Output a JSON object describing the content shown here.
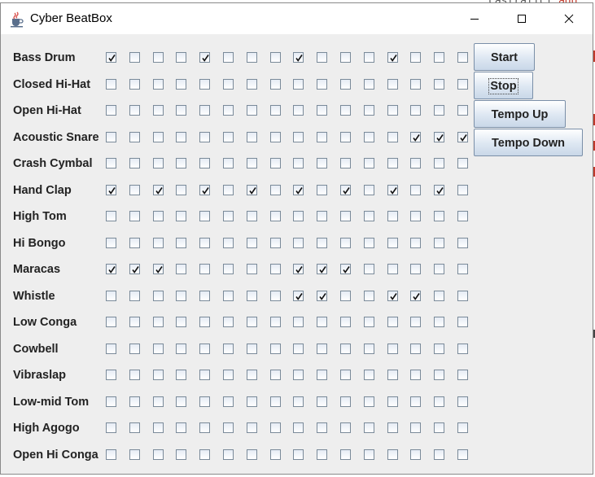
{
  "window": {
    "title": "Cyber BeatBox"
  },
  "background": {
    "code_prefix": "castrafici.",
    "code_highlight": "add"
  },
  "instruments": [
    "Bass Drum",
    "Closed Hi-Hat",
    "Open Hi-Hat",
    "Acoustic Snare",
    "Crash Cymbal",
    "Hand Clap",
    "High Tom",
    "Hi Bongo",
    "Maracas",
    "Whistle",
    "Low Conga",
    "Cowbell",
    "Vibraslap",
    "Low-mid Tom",
    "High Agogo",
    "Open Hi Conga"
  ],
  "beats_per_row": 16,
  "pattern": [
    [
      1,
      0,
      0,
      0,
      1,
      0,
      0,
      0,
      1,
      0,
      0,
      0,
      1,
      0,
      0,
      0
    ],
    [
      0,
      0,
      0,
      0,
      0,
      0,
      0,
      0,
      0,
      0,
      0,
      0,
      0,
      0,
      0,
      0
    ],
    [
      0,
      0,
      0,
      0,
      0,
      0,
      0,
      0,
      0,
      0,
      0,
      0,
      0,
      0,
      0,
      0
    ],
    [
      0,
      0,
      0,
      0,
      0,
      0,
      0,
      0,
      0,
      0,
      0,
      0,
      0,
      1,
      1,
      1
    ],
    [
      0,
      0,
      0,
      0,
      0,
      0,
      0,
      0,
      0,
      0,
      0,
      0,
      0,
      0,
      0,
      0
    ],
    [
      1,
      0,
      1,
      0,
      1,
      0,
      1,
      0,
      1,
      0,
      1,
      0,
      1,
      0,
      1,
      0
    ],
    [
      0,
      0,
      0,
      0,
      0,
      0,
      0,
      0,
      0,
      0,
      0,
      0,
      0,
      0,
      0,
      0
    ],
    [
      0,
      0,
      0,
      0,
      0,
      0,
      0,
      0,
      0,
      0,
      0,
      0,
      0,
      0,
      0,
      0
    ],
    [
      1,
      1,
      1,
      0,
      0,
      0,
      0,
      0,
      1,
      1,
      1,
      0,
      0,
      0,
      0,
      0
    ],
    [
      0,
      0,
      0,
      0,
      0,
      0,
      0,
      0,
      1,
      1,
      0,
      0,
      1,
      1,
      0,
      0
    ],
    [
      0,
      0,
      0,
      0,
      0,
      0,
      0,
      0,
      0,
      0,
      0,
      0,
      0,
      0,
      0,
      0
    ],
    [
      0,
      0,
      0,
      0,
      0,
      0,
      0,
      0,
      0,
      0,
      0,
      0,
      0,
      0,
      0,
      0
    ],
    [
      0,
      0,
      0,
      0,
      0,
      0,
      0,
      0,
      0,
      0,
      0,
      0,
      0,
      0,
      0,
      0
    ],
    [
      0,
      0,
      0,
      0,
      0,
      0,
      0,
      0,
      0,
      0,
      0,
      0,
      0,
      0,
      0,
      0
    ],
    [
      0,
      0,
      0,
      0,
      0,
      0,
      0,
      0,
      0,
      0,
      0,
      0,
      0,
      0,
      0,
      0
    ],
    [
      0,
      0,
      0,
      0,
      0,
      0,
      0,
      0,
      0,
      0,
      0,
      0,
      0,
      0,
      0,
      0
    ]
  ],
  "buttons": {
    "start": "Start",
    "stop": "Stop",
    "tempo_up": "Tempo Up",
    "tempo_down": "Tempo Down"
  },
  "colors": {
    "window_bg": "#eeeeee",
    "button_border": "#7a8fa8",
    "checkbox_border": "#7a8a99"
  },
  "icons": {
    "app": "java-coffee-icon",
    "minimize": "minimize-icon",
    "maximize": "maximize-icon",
    "close": "close-icon",
    "check": "checkmark-icon"
  }
}
